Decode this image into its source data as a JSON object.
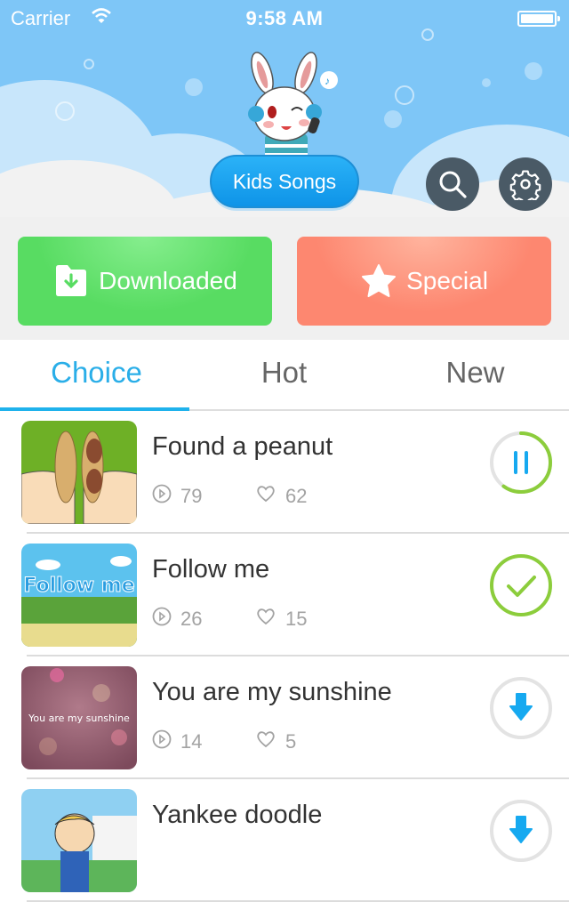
{
  "status_bar": {
    "carrier": "Carrier",
    "time": "9:58 AM"
  },
  "header": {
    "main_button": "Kids Songs",
    "search_icon": "search-icon",
    "settings_icon": "gear-icon"
  },
  "quick_actions": [
    {
      "label": "Downloaded",
      "icon": "download-folder-icon",
      "color": "#58dc62"
    },
    {
      "label": "Special",
      "icon": "star-icon",
      "color": "#fd8770"
    }
  ],
  "tabs": [
    {
      "label": "Choice",
      "active": true
    },
    {
      "label": "Hot",
      "active": false
    },
    {
      "label": "New",
      "active": false
    }
  ],
  "songs": [
    {
      "title": "Found a peanut",
      "plays": "79",
      "likes": "62",
      "state": "downloading",
      "progress": 0.6,
      "thumb_text": ""
    },
    {
      "title": "Follow me",
      "plays": "26",
      "likes": "15",
      "state": "downloaded",
      "thumb_text": "Follow me"
    },
    {
      "title": "You are my sunshine",
      "plays": "14",
      "likes": "5",
      "state": "download",
      "thumb_text": "You are my sunshine"
    },
    {
      "title": "Yankee doodle",
      "plays": "",
      "likes": "",
      "state": "download",
      "thumb_text": ""
    }
  ],
  "colors": {
    "accent": "#2aaee8",
    "done": "#8ccd3c",
    "download": "#16a9f0"
  }
}
